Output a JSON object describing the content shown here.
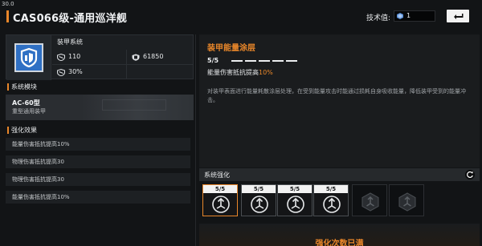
{
  "fps": "30.0",
  "header": {
    "title": "CAS066级-通用巡洋舰",
    "tech_label": "技术值:",
    "tech_value": "1",
    "back_icon": "back-arrow-icon"
  },
  "module": {
    "name": "装甲系统",
    "icon": "armor-shield-icon",
    "stats": [
      {
        "icon": "armor-icon",
        "value": "110"
      },
      {
        "icon": "hull-icon",
        "value": "61850"
      },
      {
        "icon": "armor-icon",
        "value": "30%"
      }
    ]
  },
  "system_module": {
    "header": "系统模块",
    "name": "AC-60型",
    "type": "重型通用装甲"
  },
  "effects": {
    "header": "强化效果",
    "items": [
      "能量伤害抵抗提高10%",
      "物理伤害抵抗提高30",
      "物理伤害抵抗提高30",
      "能量伤害抵抗提高10%"
    ]
  },
  "detail": {
    "title": "装甲能量涂层",
    "level": "5/5",
    "level_max": 5,
    "effect_prefix": "能量伤害抵抗提高",
    "effect_value": "10%",
    "description": "对装甲表面进行能量耗散涂层处理，在受到能量攻击时能通过损耗自身吸收能量，降低装甲受到的能量冲击。"
  },
  "strengthen": {
    "header": "系统强化",
    "refresh_icon": "refresh-icon",
    "slots": [
      {
        "label": "5/5",
        "state": "selected"
      },
      {
        "label": "5/5",
        "state": "active"
      },
      {
        "label": "5/5",
        "state": "active"
      },
      {
        "label": "5/5",
        "state": "active"
      },
      {
        "label": "",
        "state": "locked"
      },
      {
        "label": "",
        "state": "locked"
      }
    ],
    "max_text": "强化次数已满"
  },
  "colors": {
    "accent": "#e8862a",
    "icon_blue": "#2f70c4"
  }
}
